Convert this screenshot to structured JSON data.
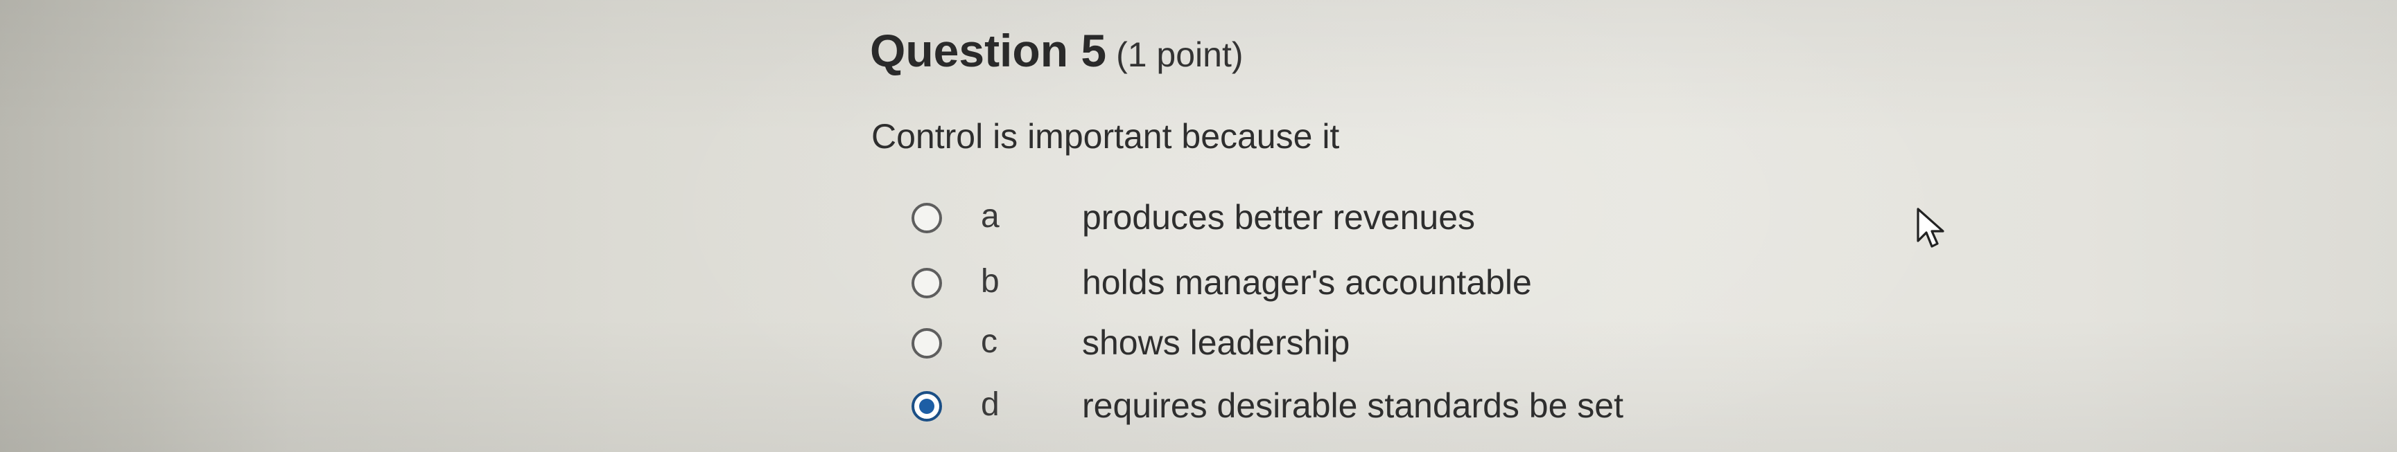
{
  "question": {
    "title": "Question 5",
    "points": "(1 point)",
    "prompt": "Control is important because it",
    "options": [
      {
        "letter": "a",
        "text": "produces better revenues",
        "selected": false
      },
      {
        "letter": "b",
        "text": "holds manager's accountable",
        "selected": false
      },
      {
        "letter": "c",
        "text": "shows leadership",
        "selected": false
      },
      {
        "letter": "d",
        "text": "requires desirable standards be set",
        "selected": true
      }
    ]
  },
  "cursor": {
    "icon": "mouse-pointer-icon"
  },
  "colors": {
    "selected_radio": "#1d5ea5",
    "text": "#2e2e2e"
  }
}
